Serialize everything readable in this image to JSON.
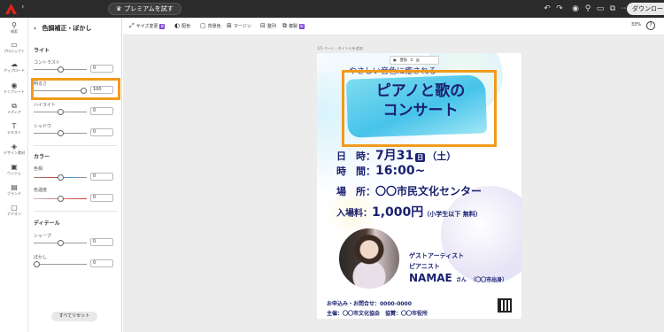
{
  "topbar": {
    "premium_label": "プレミアムを試す",
    "download_label": "ダウンロー"
  },
  "rail": {
    "items": [
      {
        "label": "検索",
        "icon": "search-icon"
      },
      {
        "label": "プロジェクト",
        "icon": "folder-icon"
      },
      {
        "label": "アップロード",
        "icon": "upload-icon"
      },
      {
        "label": "テンプレート",
        "icon": "template-icon"
      },
      {
        "label": "メディア",
        "icon": "media-icon"
      },
      {
        "label": "テキスト",
        "icon": "text-icon"
      },
      {
        "label": "デザイン素材",
        "icon": "shapes-icon"
      },
      {
        "label": "ウィジェ",
        "icon": "widget-icon"
      },
      {
        "label": "ブランド",
        "icon": "brand-icon"
      },
      {
        "label": "アドオン",
        "icon": "addon-icon"
      }
    ]
  },
  "panel": {
    "title": "色調補正・ぼかし",
    "sections": {
      "light": "ライト",
      "color": "カラー",
      "detail": "ディテール"
    },
    "sliders": {
      "contrast": {
        "label": "コントラスト",
        "value": "0"
      },
      "brightness": {
        "label": "明るさ",
        "value": "100"
      },
      "highlight": {
        "label": "ハイライト",
        "value": "0"
      },
      "shadow": {
        "label": "シャドウ",
        "value": "0"
      },
      "hue": {
        "label": "色相",
        "value": "0"
      },
      "saturation": {
        "label": "色温度",
        "value": "0"
      },
      "sharpen": {
        "label": "シャープ",
        "value": "0"
      },
      "blur": {
        "label": "ぼかし",
        "value": "0"
      }
    },
    "reset_label": "すべてリセット"
  },
  "toolbar": {
    "resize": "サイズ変更",
    "design": "配色",
    "background": "背景色",
    "margin": "マージン",
    "grid": "整列",
    "copy": "複製",
    "badge": "新",
    "zoom": "33%"
  },
  "canvas": {
    "page_hint": "1/1 ページ - タイトルを追加",
    "selection_tools": [
      "置換",
      "切り抜き"
    ]
  },
  "poster": {
    "subtitle": "やさしい音色に癒される",
    "title_line1": "ピアノと歌の",
    "title_line2": "コンサート",
    "date_label": "日　時：",
    "date_value": "7月31",
    "date_day": "日",
    "date_week": "（土）",
    "time_label": "時　間：",
    "time_value": "16:00~",
    "place_label": "場　所：",
    "place_value": "〇〇市民文化センター",
    "fee_label": "入場料：",
    "fee_value": "1,000円",
    "fee_note": "（小学生以下 無料）",
    "guest_label": "ゲストアーティスト",
    "guest_role": "ピアニスト",
    "guest_name": "NAMAE",
    "guest_suffix": "さん",
    "guest_origin": "（〇〇市出身）",
    "contact": "お申込み・お問合せ：0000-0000",
    "organizer": "主催：〇〇市文化協会　協賛：〇〇市役所"
  }
}
